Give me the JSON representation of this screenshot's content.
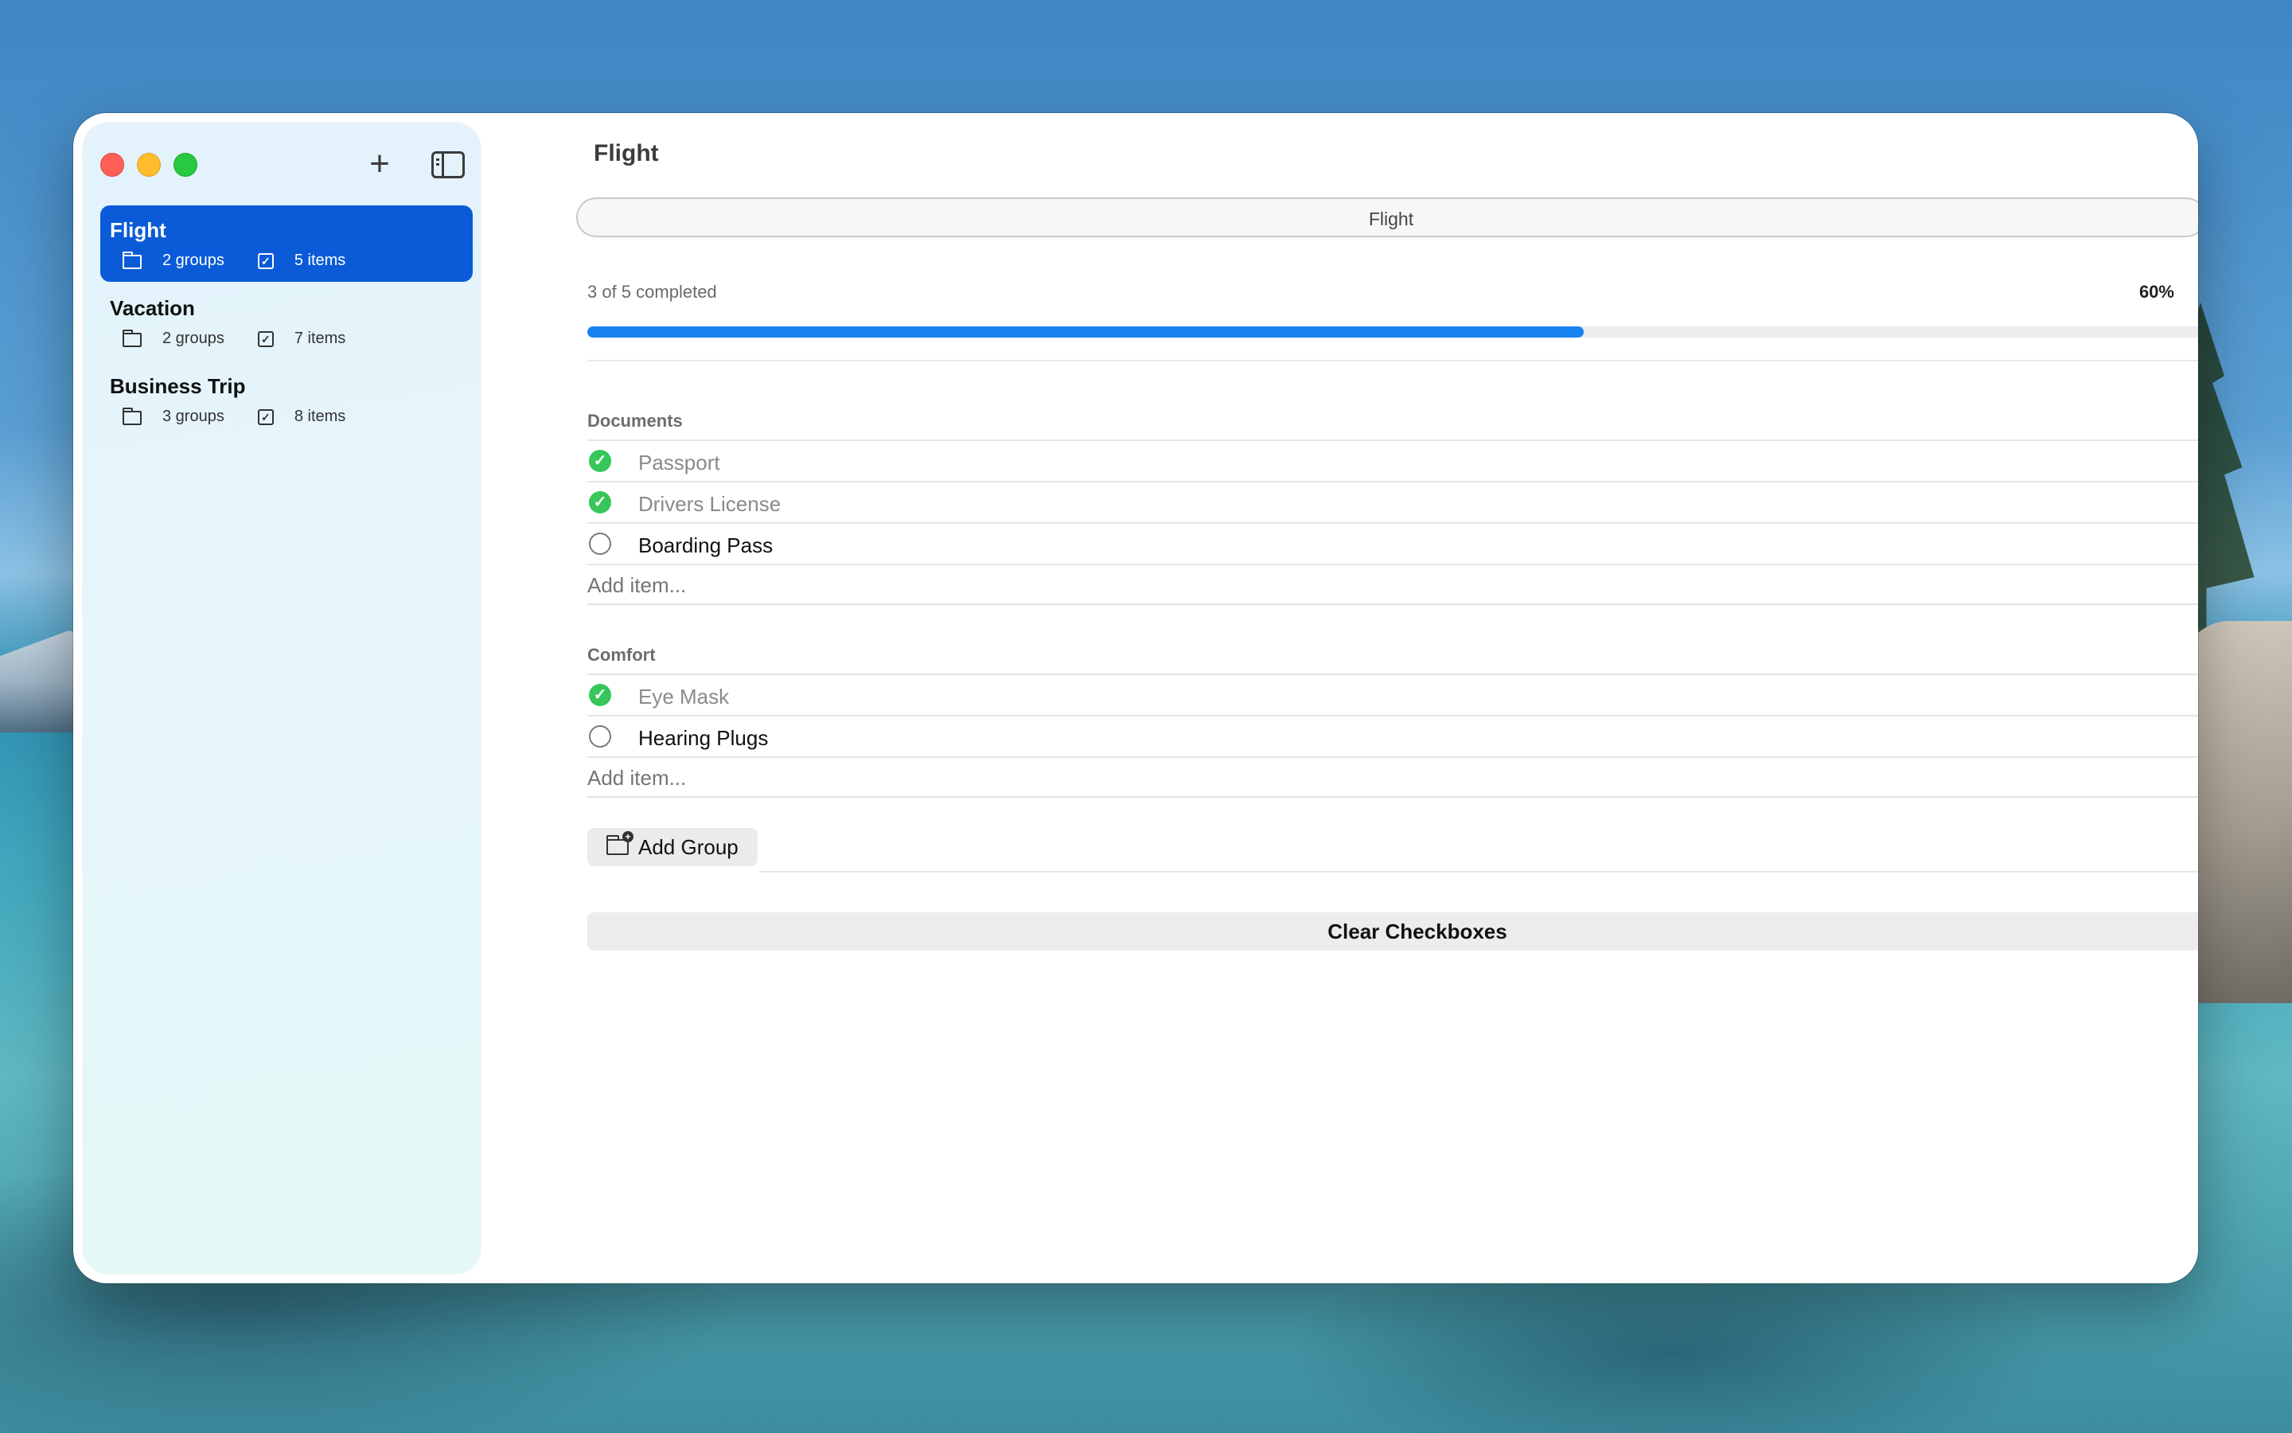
{
  "sidebar": {
    "items": [
      {
        "title": "Flight",
        "groups": "2 groups",
        "items": "5 items",
        "selected": true
      },
      {
        "title": "Vacation",
        "groups": "2 groups",
        "items": "7 items",
        "selected": false
      },
      {
        "title": "Business Trip",
        "groups": "3 groups",
        "items": "8 items",
        "selected": false
      }
    ],
    "add_icon": "plus-icon",
    "toggle_icon": "sidebar-toggle-icon"
  },
  "main": {
    "title": "Flight",
    "name_field_value": "Flight",
    "progress": {
      "text": "3 of 5 completed",
      "percent_label": "60%",
      "fraction": 0.6
    },
    "groups": [
      {
        "title": "Documents",
        "items": [
          {
            "label": "Passport",
            "checked": true
          },
          {
            "label": "Drivers License",
            "checked": true
          },
          {
            "label": "Boarding Pass",
            "checked": false
          }
        ],
        "add_placeholder": "Add item..."
      },
      {
        "title": "Comfort",
        "items": [
          {
            "label": "Eye Mask",
            "checked": true
          },
          {
            "label": "Hearing Plugs",
            "checked": false
          }
        ],
        "add_placeholder": "Add item..."
      }
    ],
    "add_group_label": "Add Group",
    "clear_label": "Clear Checkboxes"
  },
  "colors": {
    "accent": "#0b5bd8",
    "progress": "#1883f1",
    "check_green": "#36c659",
    "remove_red": "#f0423a"
  }
}
